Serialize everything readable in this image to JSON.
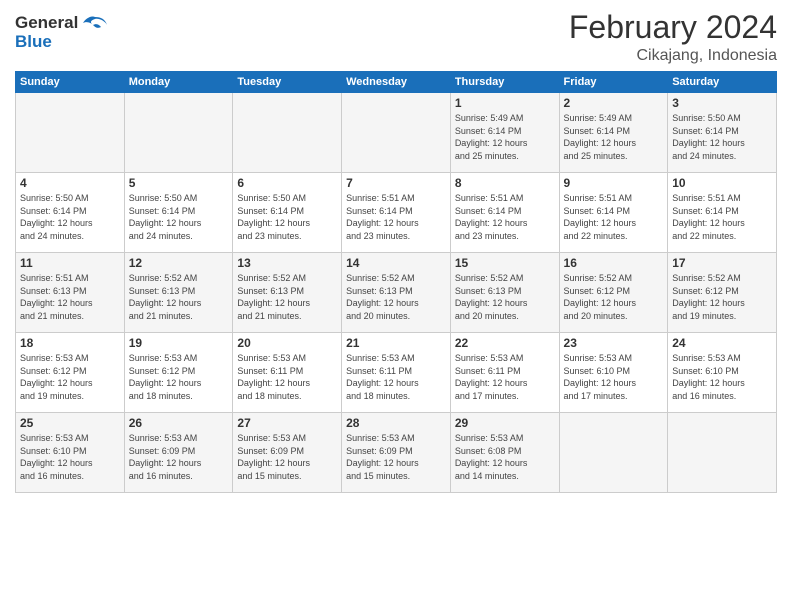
{
  "header": {
    "logo_line1": "General",
    "logo_line2": "Blue",
    "title": "February 2024",
    "subtitle": "Cikajang, Indonesia"
  },
  "days_of_week": [
    "Sunday",
    "Monday",
    "Tuesday",
    "Wednesday",
    "Thursday",
    "Friday",
    "Saturday"
  ],
  "weeks": [
    [
      {
        "day": "",
        "info": ""
      },
      {
        "day": "",
        "info": ""
      },
      {
        "day": "",
        "info": ""
      },
      {
        "day": "",
        "info": ""
      },
      {
        "day": "1",
        "info": "Sunrise: 5:49 AM\nSunset: 6:14 PM\nDaylight: 12 hours\nand 25 minutes."
      },
      {
        "day": "2",
        "info": "Sunrise: 5:49 AM\nSunset: 6:14 PM\nDaylight: 12 hours\nand 25 minutes."
      },
      {
        "day": "3",
        "info": "Sunrise: 5:50 AM\nSunset: 6:14 PM\nDaylight: 12 hours\nand 24 minutes."
      }
    ],
    [
      {
        "day": "4",
        "info": "Sunrise: 5:50 AM\nSunset: 6:14 PM\nDaylight: 12 hours\nand 24 minutes."
      },
      {
        "day": "5",
        "info": "Sunrise: 5:50 AM\nSunset: 6:14 PM\nDaylight: 12 hours\nand 24 minutes."
      },
      {
        "day": "6",
        "info": "Sunrise: 5:50 AM\nSunset: 6:14 PM\nDaylight: 12 hours\nand 23 minutes."
      },
      {
        "day": "7",
        "info": "Sunrise: 5:51 AM\nSunset: 6:14 PM\nDaylight: 12 hours\nand 23 minutes."
      },
      {
        "day": "8",
        "info": "Sunrise: 5:51 AM\nSunset: 6:14 PM\nDaylight: 12 hours\nand 23 minutes."
      },
      {
        "day": "9",
        "info": "Sunrise: 5:51 AM\nSunset: 6:14 PM\nDaylight: 12 hours\nand 22 minutes."
      },
      {
        "day": "10",
        "info": "Sunrise: 5:51 AM\nSunset: 6:14 PM\nDaylight: 12 hours\nand 22 minutes."
      }
    ],
    [
      {
        "day": "11",
        "info": "Sunrise: 5:51 AM\nSunset: 6:13 PM\nDaylight: 12 hours\nand 21 minutes."
      },
      {
        "day": "12",
        "info": "Sunrise: 5:52 AM\nSunset: 6:13 PM\nDaylight: 12 hours\nand 21 minutes."
      },
      {
        "day": "13",
        "info": "Sunrise: 5:52 AM\nSunset: 6:13 PM\nDaylight: 12 hours\nand 21 minutes."
      },
      {
        "day": "14",
        "info": "Sunrise: 5:52 AM\nSunset: 6:13 PM\nDaylight: 12 hours\nand 20 minutes."
      },
      {
        "day": "15",
        "info": "Sunrise: 5:52 AM\nSunset: 6:13 PM\nDaylight: 12 hours\nand 20 minutes."
      },
      {
        "day": "16",
        "info": "Sunrise: 5:52 AM\nSunset: 6:12 PM\nDaylight: 12 hours\nand 20 minutes."
      },
      {
        "day": "17",
        "info": "Sunrise: 5:52 AM\nSunset: 6:12 PM\nDaylight: 12 hours\nand 19 minutes."
      }
    ],
    [
      {
        "day": "18",
        "info": "Sunrise: 5:53 AM\nSunset: 6:12 PM\nDaylight: 12 hours\nand 19 minutes."
      },
      {
        "day": "19",
        "info": "Sunrise: 5:53 AM\nSunset: 6:12 PM\nDaylight: 12 hours\nand 18 minutes."
      },
      {
        "day": "20",
        "info": "Sunrise: 5:53 AM\nSunset: 6:11 PM\nDaylight: 12 hours\nand 18 minutes."
      },
      {
        "day": "21",
        "info": "Sunrise: 5:53 AM\nSunset: 6:11 PM\nDaylight: 12 hours\nand 18 minutes."
      },
      {
        "day": "22",
        "info": "Sunrise: 5:53 AM\nSunset: 6:11 PM\nDaylight: 12 hours\nand 17 minutes."
      },
      {
        "day": "23",
        "info": "Sunrise: 5:53 AM\nSunset: 6:10 PM\nDaylight: 12 hours\nand 17 minutes."
      },
      {
        "day": "24",
        "info": "Sunrise: 5:53 AM\nSunset: 6:10 PM\nDaylight: 12 hours\nand 16 minutes."
      }
    ],
    [
      {
        "day": "25",
        "info": "Sunrise: 5:53 AM\nSunset: 6:10 PM\nDaylight: 12 hours\nand 16 minutes."
      },
      {
        "day": "26",
        "info": "Sunrise: 5:53 AM\nSunset: 6:09 PM\nDaylight: 12 hours\nand 16 minutes."
      },
      {
        "day": "27",
        "info": "Sunrise: 5:53 AM\nSunset: 6:09 PM\nDaylight: 12 hours\nand 15 minutes."
      },
      {
        "day": "28",
        "info": "Sunrise: 5:53 AM\nSunset: 6:09 PM\nDaylight: 12 hours\nand 15 minutes."
      },
      {
        "day": "29",
        "info": "Sunrise: 5:53 AM\nSunset: 6:08 PM\nDaylight: 12 hours\nand 14 minutes."
      },
      {
        "day": "",
        "info": ""
      },
      {
        "day": "",
        "info": ""
      }
    ]
  ]
}
